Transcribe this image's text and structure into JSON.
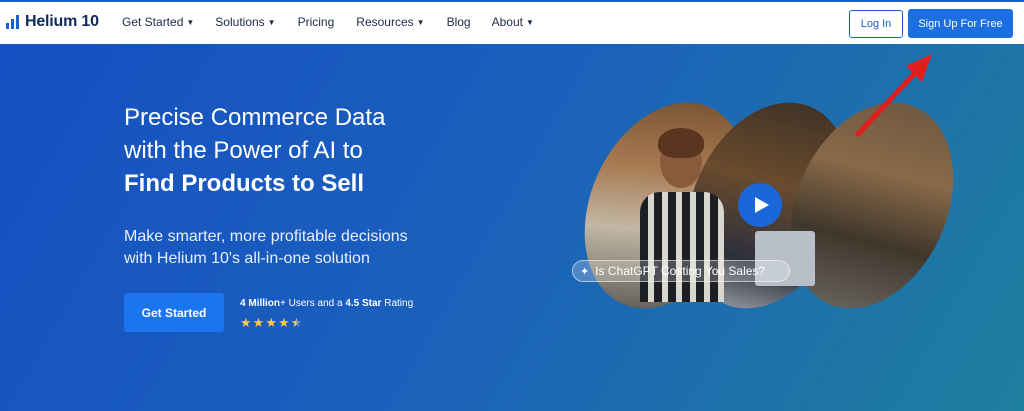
{
  "header": {
    "logo_text": "Helium 10",
    "nav": [
      {
        "label": "Get Started",
        "has_caret": true
      },
      {
        "label": "Solutions",
        "has_caret": true
      },
      {
        "label": "Pricing",
        "has_caret": false
      },
      {
        "label": "Resources",
        "has_caret": true
      },
      {
        "label": "Blog",
        "has_caret": false
      },
      {
        "label": "About",
        "has_caret": true
      }
    ],
    "login_label": "Log In",
    "signup_label": "Sign Up For Free"
  },
  "hero": {
    "headline_line1": "Precise Commerce Data",
    "headline_line2": "with the Power of AI to",
    "headline_line3": "Find Products to Sell",
    "subhead_line1": "Make smarter, more profitable decisions",
    "subhead_line2": "with Helium 10's all-in-one solution",
    "cta_label": "Get Started",
    "rating_users_bold": "4 Million",
    "rating_users_rest": "+ Users and a ",
    "rating_stars_bold": "4.5 Star",
    "rating_rest": " Rating",
    "rating_value": 4.5,
    "video_badge": "Is ChatGPT Costing You Sales?"
  },
  "icons": [
    "logo-bars-icon",
    "caret-down-icon",
    "play-icon",
    "sparkle-icon",
    "star-icon",
    "red-arrow-annotation"
  ],
  "colors": {
    "brand_blue": "#1b5fd1",
    "button_blue": "#1b74f0",
    "star_yellow": "#f7c948",
    "annotation_red": "#e01e1e"
  }
}
